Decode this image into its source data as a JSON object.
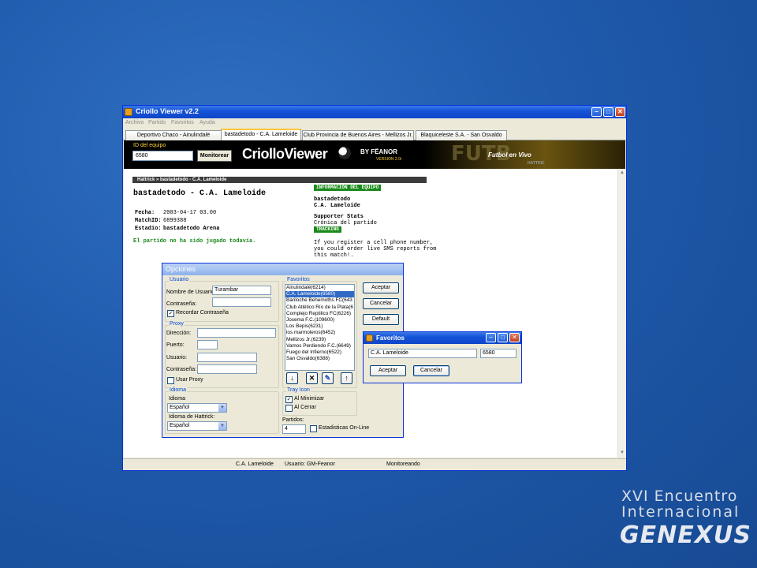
{
  "window": {
    "title": "Criollo Viewer v2.2",
    "menu": [
      "Archivo",
      "Partido",
      "Favoritos",
      "Ayuda"
    ],
    "tabs": [
      {
        "label": "Deportivo Chaco - Ainulindalë"
      },
      {
        "label": "bastadetodo - C.A. Lameloide"
      },
      {
        "label": "Club Provincia de Buenos Aires - Mellizos Jr."
      },
      {
        "label": "Blaquiceleste S.A. - San Osvaldo"
      }
    ],
    "active_tab": 1
  },
  "banner": {
    "id_label": "ID del equipo",
    "id_value": "6580",
    "monitor_button": "Monitorear",
    "logo_text": "CriolloViewer",
    "logo_by": "BY FËANOR",
    "logo_version": "VERSION 2.0i",
    "art_futbol": "FUTB",
    "art_envivo": "Futbol en Vivo",
    "art_hattrick": "HATTRIC"
  },
  "match": {
    "breadcrumb": "Hattrick » bastadetodo - C.A. Lameloide",
    "title": "bastadetodo - C.A. Lameloide",
    "fecha_label": "Fecha:",
    "fecha_value": "2003-04-17 03.00",
    "matchid_label": "MatchID:",
    "matchid_value": "6899388",
    "estadio_label": "Estadio:",
    "estadio_value": "bastadetodo Arena",
    "played_note": "El partido no ha sido jugado todavía.",
    "info_header": "INFORMACIÓN DEL EQUIPO",
    "team1": "bastadetodo",
    "team2": "C.A. Lameloide",
    "supporter_stats": "Supporter Stats",
    "cronica": "Crónica del partido",
    "tracking": "TRACKING",
    "sms_1": "If you register a cell phone number,",
    "sms_2": "you could order live SMS reports from",
    "sms_3": "this match!."
  },
  "statusbar": {
    "team": "C.A. Lameloide",
    "user": "Usuario: GM-Feanor",
    "status": "Monitoreando"
  },
  "opciones": {
    "title": "Opciones",
    "usuario_group": "Usuario",
    "nombre_label": "Nombre de Usuario:",
    "nombre_value": "Turambar",
    "contrasena_label": "Contraseña:",
    "contrasena_value": "",
    "recordar_label": "Recordar Contraseña",
    "recordar_checked": true,
    "proxy_group": "Proxy",
    "direccion_label": "Dirección:",
    "puerto_label": "Puerto:",
    "proxy_usuario_label": "Usuario:",
    "proxy_contrasena_label": "Contraseña:",
    "usar_proxy_label": "Usar Proxy",
    "usar_proxy_checked": false,
    "idioma_group": "Idioma",
    "idioma_label": "Idioma",
    "idioma_value": "Español",
    "idioma_hattrick_label": "Idioma de Hattrick:",
    "idioma_hattrick_value": "Español",
    "favoritos_group": "Favoritos",
    "favoritos": [
      "Ainulindalë(6214)",
      "C.A. Lameloide(6580)",
      "Bariloche Behemoths FC(643",
      "Club Atlético Río de la Plata(6",
      "Complejo Reptilico FC(6226)",
      "Josema F.C.(109600)",
      "Los Bepis(6231)",
      "los marmoleros(6452)",
      "Mellizos Jr.(6239)",
      "Vamos Perdiendo F.C.(6649)",
      "Fuego del Infierno(6522)",
      "San Osvaldo(6388)"
    ],
    "favoritos_selected": 1,
    "aceptar": "Aceptar",
    "cancelar": "Cancelar",
    "default": "Default",
    "tray_group": "Tray Icon",
    "al_minimizar": "Al Minimizar",
    "al_minimizar_checked": true,
    "al_cerrar": "Al Cerrar",
    "al_cerrar_checked": false,
    "partidos_label": "Partidos:",
    "partidos_value": "4",
    "estadisticas_label": "Estadisticas On-Line",
    "estadisticas_checked": false
  },
  "favoritos_dialog": {
    "title": "Favoritos",
    "name_value": "C.A. Lameloide",
    "id_value": "6580",
    "aceptar": "Aceptar",
    "cancelar": "Cancelar"
  },
  "branding": {
    "line1": "XVI Encuentro",
    "line2": "Internacional",
    "logo": "GENEXUS"
  }
}
